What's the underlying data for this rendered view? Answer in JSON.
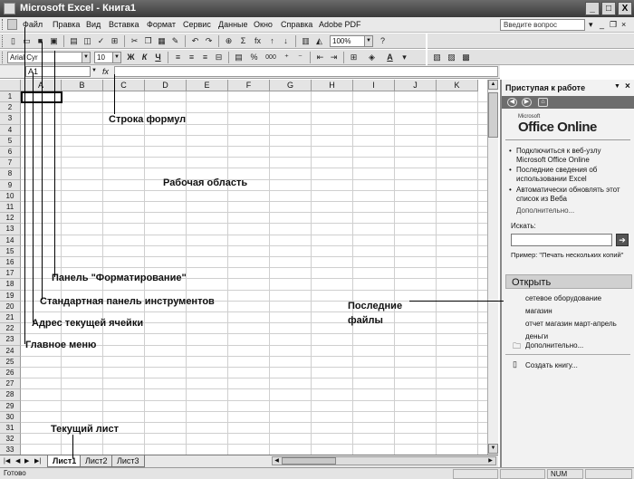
{
  "window": {
    "title": "Microsoft Excel - Книга1",
    "min": "_",
    "max": "□",
    "close": "X"
  },
  "menu": {
    "items": [
      "Файл",
      "Правка",
      "Вид",
      "Вставка",
      "Формат",
      "Сервис",
      "Данные",
      "Окно",
      "Справка",
      "Adobe PDF"
    ],
    "help_placeholder": "Введите вопрос",
    "help_dropdown": "▾",
    "doc_min": "_",
    "doc_restore": "❐",
    "doc_close": "×"
  },
  "standard_toolbar": {
    "zoom": "100%",
    "sigma": "Σ",
    "fx": "fx"
  },
  "formatting_toolbar": {
    "font": "Arial Cyr",
    "size": "10",
    "bold": "Ж",
    "italic": "К",
    "underline": "Ч",
    "percent": "%",
    "thousands": "000",
    "font_color_letter": "A"
  },
  "formula_bar": {
    "name_box": "A1",
    "fx": "fx"
  },
  "grid": {
    "columns": [
      "A",
      "B",
      "C",
      "D",
      "E",
      "F",
      "G",
      "H",
      "I",
      "J",
      "K"
    ],
    "rows": [
      "1",
      "2",
      "3",
      "4",
      "5",
      "6",
      "7",
      "8",
      "9",
      "10",
      "11",
      "12",
      "13",
      "14",
      "15",
      "16",
      "17",
      "18",
      "19",
      "20",
      "21",
      "22",
      "23",
      "24",
      "25",
      "26",
      "27",
      "28",
      "29",
      "30",
      "31",
      "32",
      "33"
    ]
  },
  "sheets": {
    "tabs": [
      "Лист1",
      "Лист2",
      "Лист3"
    ],
    "active": 0
  },
  "status": {
    "ready": "Готово",
    "num": "NUM"
  },
  "task_pane": {
    "title": "Приступая к работе",
    "close": "×",
    "logo_small": "Microsoft",
    "logo_big": "Office Online",
    "bullets": [
      "Подключиться к веб-узлу Microsoft Office Online",
      "Последние сведения об использовании Excel",
      "Автоматически обновлять этот список из Веба"
    ],
    "more": "Дополнительно...",
    "search_label": "Искать:",
    "search_go": "➔",
    "example": "Пример: \"Печать нескольких копий\"",
    "open_heading": "Открыть",
    "recent_files": [
      "сетевое оборудование",
      "магазин",
      "отчет магазин март-апрель",
      "деньги"
    ],
    "open_more": "Дополнительно...",
    "create": "Создать книгу..."
  },
  "annotations": {
    "formula_bar": "Строка формул",
    "work_area": "Рабочая область",
    "formatting_panel": "Панель \"Форматирование\"",
    "standard_panel": "Стандартная панель инструментов",
    "cell_address": "Адрес текущей ячейки",
    "main_menu": "Главное меню",
    "recent_files_1": "Последние",
    "recent_files_2": "файлы",
    "current_sheet": "Текущий лист"
  }
}
